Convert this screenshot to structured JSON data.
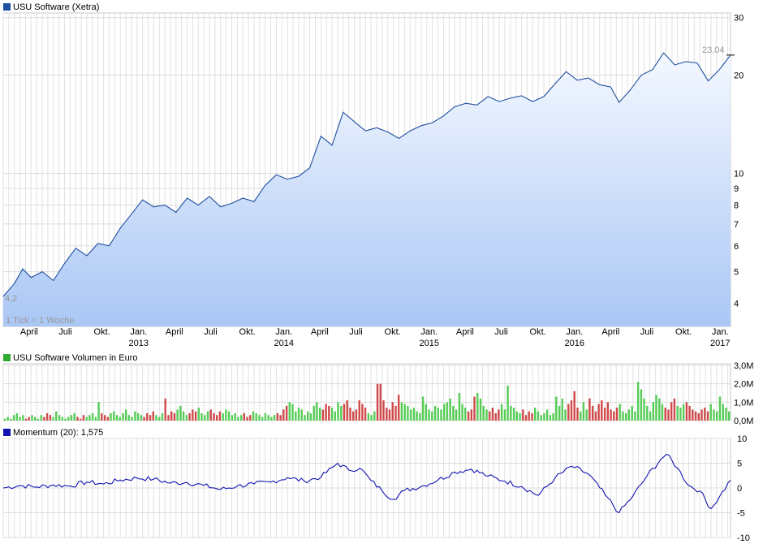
{
  "panels": {
    "price": {
      "title": "USU Software (Xetra)",
      "swatch_color": "#1f4fa0",
      "first_label": "4,2",
      "last_label": "23,04",
      "tick_note": "1 Tick = 1 Woche"
    },
    "volume": {
      "title": "USU Software Volumen in Euro",
      "swatch_color": "#33aa33"
    },
    "momentum": {
      "title": "Momentum (20): 1,575",
      "swatch_color": "#1414b4"
    }
  },
  "chart_data": [
    {
      "id": "price",
      "type": "area",
      "scale": "log",
      "ylim": [
        3.4,
        31
      ],
      "y_ticks": [
        4,
        5,
        6,
        7,
        8,
        9,
        10,
        20,
        30
      ],
      "x_range": [
        "2012-01-27",
        "2017-01-27"
      ],
      "month_labels": [
        {
          "date": "2012-04-01",
          "label": "April"
        },
        {
          "date": "2012-07-01",
          "label": "Juli"
        },
        {
          "date": "2012-10-01",
          "label": "Okt."
        },
        {
          "date": "2013-01-01",
          "label": "Jan.",
          "year": "2013"
        },
        {
          "date": "2013-04-01",
          "label": "April"
        },
        {
          "date": "2013-07-01",
          "label": "Juli"
        },
        {
          "date": "2013-10-01",
          "label": "Okt."
        },
        {
          "date": "2014-01-01",
          "label": "Jan.",
          "year": "2014"
        },
        {
          "date": "2014-04-01",
          "label": "April"
        },
        {
          "date": "2014-07-01",
          "label": "Juli"
        },
        {
          "date": "2014-10-01",
          "label": "Okt."
        },
        {
          "date": "2015-01-01",
          "label": "Jan.",
          "year": "2015"
        },
        {
          "date": "2015-04-01",
          "label": "April"
        },
        {
          "date": "2015-07-01",
          "label": "Juli"
        },
        {
          "date": "2015-10-01",
          "label": "Okt."
        },
        {
          "date": "2016-01-01",
          "label": "Jan.",
          "year": "2016"
        },
        {
          "date": "2016-04-01",
          "label": "April"
        },
        {
          "date": "2016-07-01",
          "label": "Juli"
        },
        {
          "date": "2016-10-01",
          "label": "Okt."
        },
        {
          "date": "2017-01-01",
          "label": "Jan.",
          "year": "2017"
        }
      ],
      "series": [
        {
          "line_color": "#1f4fa0",
          "fill_top": "#f4f8ff",
          "fill_bottom": "#aac7f5",
          "points": [
            [
              "2012-01-27",
              4.2
            ],
            [
              "2012-02-24",
              4.6
            ],
            [
              "2012-03-16",
              5.1
            ],
            [
              "2012-04-06",
              4.8
            ],
            [
              "2012-05-04",
              5.0
            ],
            [
              "2012-06-01",
              4.7
            ],
            [
              "2012-06-29",
              5.3
            ],
            [
              "2012-07-27",
              5.9
            ],
            [
              "2012-08-24",
              5.6
            ],
            [
              "2012-09-21",
              6.1
            ],
            [
              "2012-10-19",
              6.0
            ],
            [
              "2012-11-16",
              6.8
            ],
            [
              "2012-12-14",
              7.5
            ],
            [
              "2013-01-11",
              8.3
            ],
            [
              "2013-02-08",
              7.9
            ],
            [
              "2013-03-08",
              8.0
            ],
            [
              "2013-04-05",
              7.6
            ],
            [
              "2013-05-03",
              8.4
            ],
            [
              "2013-05-31",
              8.0
            ],
            [
              "2013-06-28",
              8.5
            ],
            [
              "2013-07-26",
              7.9
            ],
            [
              "2013-08-23",
              8.1
            ],
            [
              "2013-09-20",
              8.4
            ],
            [
              "2013-10-18",
              8.2
            ],
            [
              "2013-11-15",
              9.2
            ],
            [
              "2013-12-13",
              9.9
            ],
            [
              "2014-01-10",
              9.6
            ],
            [
              "2014-02-07",
              9.8
            ],
            [
              "2014-03-07",
              10.4
            ],
            [
              "2014-04-04",
              13.0
            ],
            [
              "2014-05-02",
              12.2
            ],
            [
              "2014-05-30",
              15.4
            ],
            [
              "2014-06-27",
              14.4
            ],
            [
              "2014-07-25",
              13.5
            ],
            [
              "2014-08-22",
              13.8
            ],
            [
              "2014-09-19",
              13.4
            ],
            [
              "2014-10-17",
              12.8
            ],
            [
              "2014-11-14",
              13.5
            ],
            [
              "2014-12-12",
              14.0
            ],
            [
              "2015-01-09",
              14.3
            ],
            [
              "2015-02-06",
              15.0
            ],
            [
              "2015-03-06",
              16.0
            ],
            [
              "2015-04-03",
              16.4
            ],
            [
              "2015-05-01",
              16.2
            ],
            [
              "2015-05-29",
              17.2
            ],
            [
              "2015-06-26",
              16.6
            ],
            [
              "2015-07-24",
              17.0
            ],
            [
              "2015-08-21",
              17.3
            ],
            [
              "2015-09-18",
              16.6
            ],
            [
              "2015-10-16",
              17.2
            ],
            [
              "2015-11-13",
              18.8
            ],
            [
              "2015-12-11",
              20.5
            ],
            [
              "2016-01-08",
              19.3
            ],
            [
              "2016-02-05",
              19.6
            ],
            [
              "2016-03-04",
              18.7
            ],
            [
              "2016-04-01",
              18.4
            ],
            [
              "2016-04-22",
              16.5
            ],
            [
              "2016-05-20",
              18.0
            ],
            [
              "2016-06-17",
              20.0
            ],
            [
              "2016-07-15",
              20.8
            ],
            [
              "2016-08-12",
              23.4
            ],
            [
              "2016-09-09",
              21.5
            ],
            [
              "2016-10-07",
              22.0
            ],
            [
              "2016-11-04",
              21.8
            ],
            [
              "2016-12-02",
              19.2
            ],
            [
              "2016-12-30",
              20.8
            ],
            [
              "2017-01-27",
              23.04
            ]
          ]
        }
      ]
    },
    {
      "id": "volume",
      "type": "bar",
      "ylim": [
        0,
        3.0
      ],
      "unit": "M",
      "y_ticks": [
        {
          "value": 0,
          "label": "0,0M"
        },
        {
          "value": 1,
          "label": "1,0M"
        },
        {
          "value": 2,
          "label": "2,0M"
        },
        {
          "value": 3,
          "label": "3,0M"
        }
      ],
      "up_color": "#55cc55",
      "down_color": "#d04848",
      "series": [
        {
          "name": "USU Software Volumen in Euro",
          "x": [
            "2012-01-27",
            "2017-01-27"
          ],
          "weekly_values_M": [
            0.1,
            0.2,
            0.1,
            0.3,
            0.4,
            0.2,
            0.3,
            0.1,
            0.2,
            0.3,
            0.2,
            0.1,
            0.3,
            0.2,
            0.4,
            0.3,
            0.2,
            0.5,
            0.3,
            0.2,
            0.1,
            0.2,
            0.3,
            0.4,
            0.2,
            0.1,
            0.3,
            0.2,
            0.3,
            0.4,
            0.2,
            1.0,
            0.4,
            0.3,
            0.2,
            0.4,
            0.5,
            0.3,
            0.2,
            0.4,
            0.6,
            0.3,
            0.2,
            0.5,
            0.4,
            0.3,
            0.2,
            0.4,
            0.3,
            0.5,
            0.3,
            0.2,
            0.4,
            1.2,
            0.3,
            0.5,
            0.4,
            0.6,
            0.8,
            0.5,
            0.3,
            0.4,
            0.6,
            0.5,
            0.7,
            0.4,
            0.3,
            0.5,
            0.6,
            0.4,
            0.3,
            0.5,
            0.4,
            0.6,
            0.5,
            0.3,
            0.4,
            0.2,
            0.3,
            0.4,
            0.2,
            0.3,
            0.5,
            0.4,
            0.3,
            0.2,
            0.4,
            0.3,
            0.2,
            0.3,
            0.4,
            0.3,
            0.6,
            0.8,
            1.0,
            0.9,
            0.5,
            0.7,
            0.6,
            0.3,
            0.5,
            0.4,
            0.8,
            1.0,
            0.7,
            0.6,
            0.9,
            0.8,
            0.7,
            0.5,
            1.0,
            0.8,
            0.9,
            1.1,
            0.7,
            0.5,
            0.6,
            1.1,
            0.9,
            0.7,
            0.4,
            0.3,
            0.5,
            2.0,
            2.0,
            1.1,
            0.7,
            0.6,
            1.0,
            0.8,
            1.4,
            1.0,
            0.9,
            0.8,
            0.6,
            0.7,
            0.5,
            0.4,
            1.3,
            0.9,
            0.6,
            0.5,
            0.8,
            0.7,
            0.6,
            0.9,
            1.0,
            1.2,
            0.8,
            0.6,
            1.5,
            0.9,
            0.7,
            0.5,
            0.6,
            1.3,
            1.5,
            1.2,
            0.8,
            0.6,
            0.5,
            0.7,
            0.4,
            0.6,
            0.9,
            0.6,
            1.9,
            0.8,
            0.7,
            0.5,
            0.4,
            0.6,
            0.3,
            0.5,
            0.4,
            0.7,
            0.5,
            0.3,
            0.4,
            0.6,
            0.3,
            0.4,
            1.3,
            0.8,
            1.2,
            0.6,
            0.9,
            1.1,
            1.6,
            0.7,
            0.5,
            1.0,
            0.6,
            1.2,
            0.8,
            0.5,
            0.9,
            1.1,
            0.7,
            1.0,
            0.6,
            0.5,
            0.7,
            0.9,
            0.5,
            0.4,
            0.6,
            0.8,
            0.5,
            2.1,
            1.7,
            1.2,
            0.8,
            0.5,
            1.0,
            1.4,
            1.2,
            0.9,
            0.7,
            0.6,
            1.0,
            1.2,
            0.8,
            0.7,
            0.9,
            1.0,
            0.8,
            0.6,
            0.5,
            0.4,
            0.6,
            0.7,
            0.5,
            0.9,
            0.6,
            0.5,
            1.3,
            0.9,
            0.7,
            0.5
          ]
        }
      ]
    },
    {
      "id": "momentum",
      "type": "line",
      "ylim": [
        -10,
        10
      ],
      "y_ticks": [
        10,
        5,
        0,
        -5,
        -10
      ],
      "series": [
        {
          "name": "Momentum (20)",
          "line_color": "#1414b4",
          "points": [
            [
              "2012-01-27",
              0.0
            ],
            [
              "2012-03-09",
              0.5
            ],
            [
              "2012-04-20",
              0.2
            ],
            [
              "2012-06-01",
              0.6
            ],
            [
              "2012-07-13",
              0.4
            ],
            [
              "2012-08-24",
              1.2
            ],
            [
              "2012-10-05",
              0.8
            ],
            [
              "2012-11-16",
              1.6
            ],
            [
              "2012-12-28",
              2.0
            ],
            [
              "2013-02-08",
              1.8
            ],
            [
              "2013-03-22",
              1.0
            ],
            [
              "2013-05-03",
              1.1
            ],
            [
              "2013-06-14",
              0.5
            ],
            [
              "2013-07-26",
              -0.3
            ],
            [
              "2013-09-06",
              0.4
            ],
            [
              "2013-10-18",
              0.8
            ],
            [
              "2013-11-29",
              1.2
            ],
            [
              "2014-01-10",
              2.1
            ],
            [
              "2014-02-21",
              1.4
            ],
            [
              "2014-04-04",
              2.2
            ],
            [
              "2014-05-16",
              5.0
            ],
            [
              "2014-06-13",
              3.6
            ],
            [
              "2014-07-11",
              4.0
            ],
            [
              "2014-08-08",
              1.5
            ],
            [
              "2014-09-05",
              -0.6
            ],
            [
              "2014-10-03",
              -2.3
            ],
            [
              "2014-10-31",
              -0.5
            ],
            [
              "2014-12-12",
              0.3
            ],
            [
              "2015-01-23",
              1.6
            ],
            [
              "2015-03-06",
              3.2
            ],
            [
              "2015-04-17",
              3.8
            ],
            [
              "2015-05-29",
              2.4
            ],
            [
              "2015-07-10",
              1.4
            ],
            [
              "2015-08-21",
              0.3
            ],
            [
              "2015-10-02",
              -1.5
            ],
            [
              "2015-11-13",
              2.0
            ],
            [
              "2015-12-25",
              4.4
            ],
            [
              "2016-02-05",
              2.8
            ],
            [
              "2016-03-18",
              -1.4
            ],
            [
              "2016-04-22",
              -5.0
            ],
            [
              "2016-05-27",
              -1.6
            ],
            [
              "2016-07-01",
              2.4
            ],
            [
              "2016-08-05",
              5.8
            ],
            [
              "2016-08-19",
              6.8
            ],
            [
              "2016-09-16",
              4.0
            ],
            [
              "2016-10-14",
              0.5
            ],
            [
              "2016-11-11",
              -0.6
            ],
            [
              "2016-12-09",
              -4.2
            ],
            [
              "2016-12-30",
              -1.8
            ],
            [
              "2017-01-27",
              1.575
            ]
          ]
        }
      ]
    }
  ]
}
